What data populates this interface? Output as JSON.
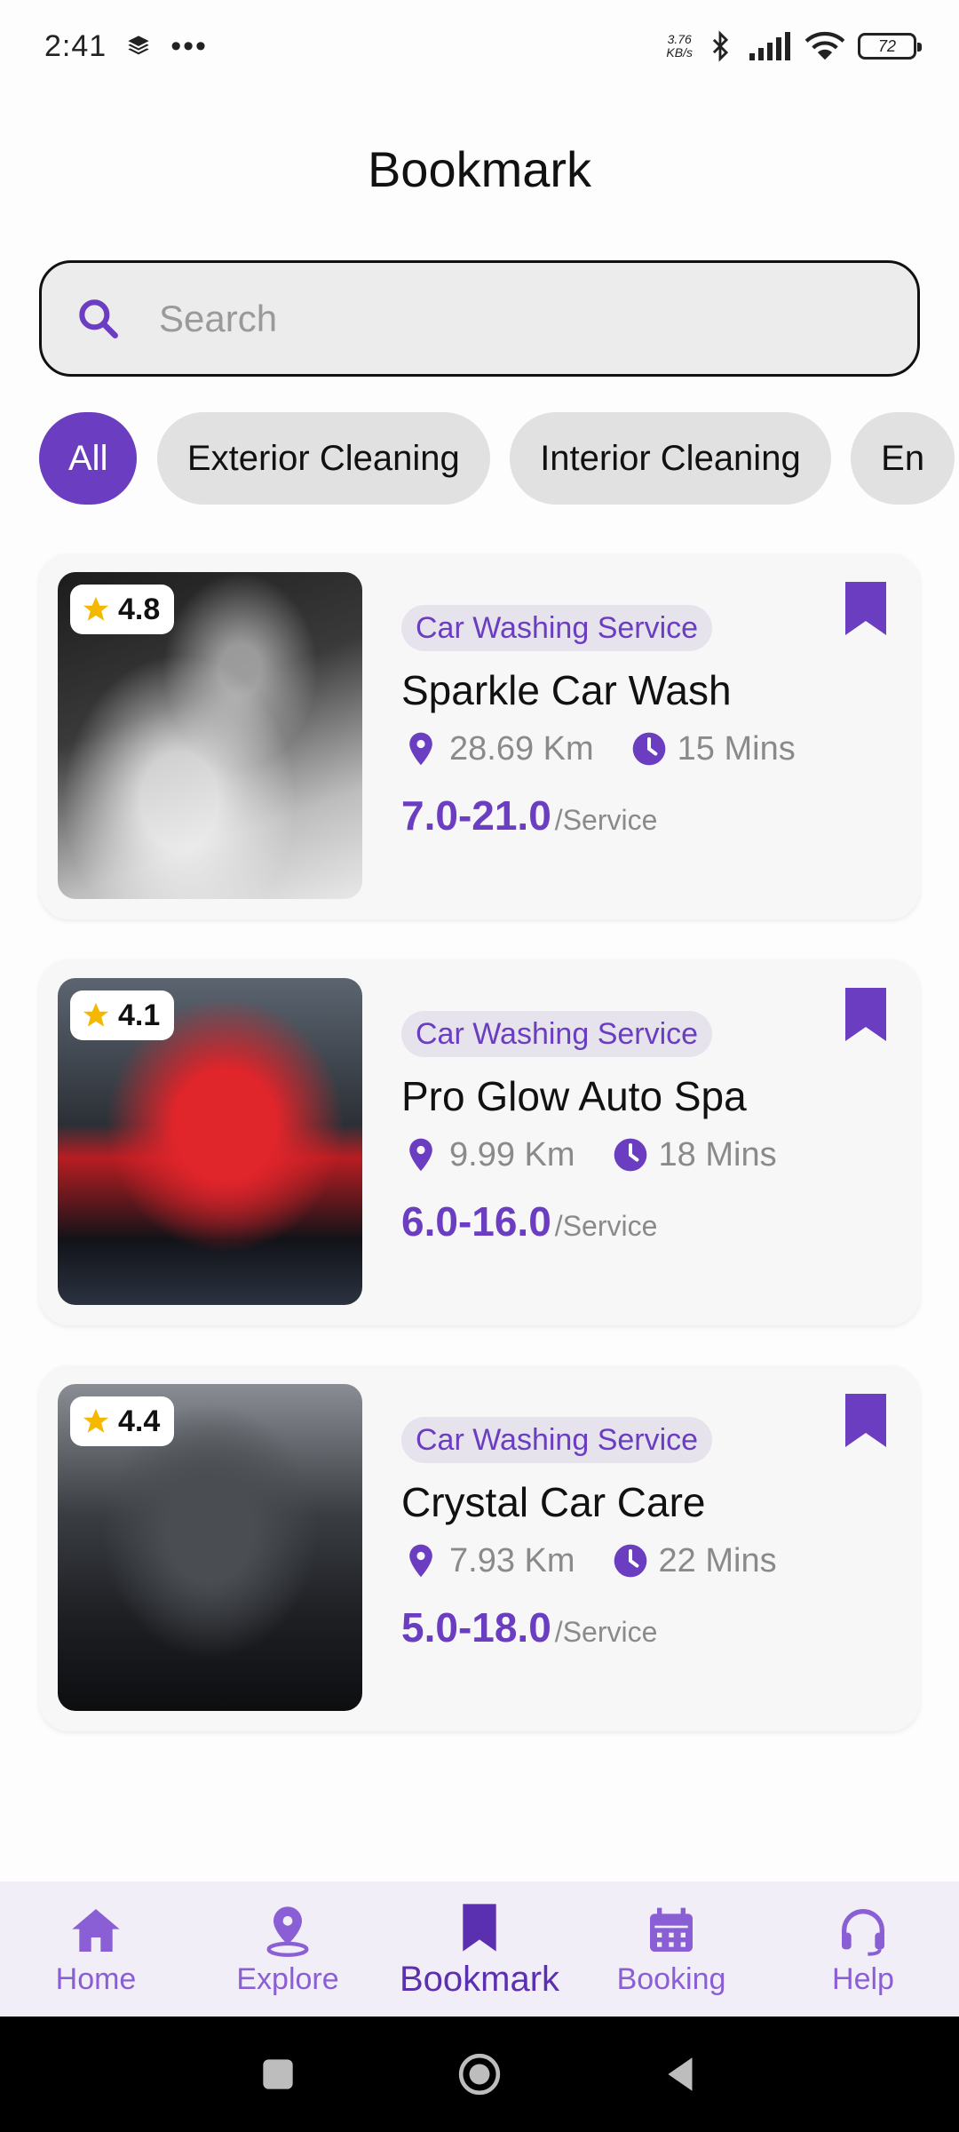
{
  "status_bar": {
    "time": "2:41",
    "more": "•••",
    "net_speed_value": "3.76",
    "net_speed_unit": "KB/s",
    "battery": "72"
  },
  "header": {
    "title": "Bookmark"
  },
  "search": {
    "placeholder": "Search"
  },
  "filters": [
    {
      "label": "All",
      "active": true
    },
    {
      "label": "Exterior Cleaning",
      "active": false
    },
    {
      "label": "Interior Cleaning",
      "active": false
    },
    {
      "label": "En",
      "active": false
    }
  ],
  "cards": [
    {
      "rating": "4.8",
      "category": "Car Washing Service",
      "name": "Sparkle Car Wash",
      "distance": "28.69 Km",
      "time": "15 Mins",
      "price": "7.0-21.0",
      "price_unit": "/Service"
    },
    {
      "rating": "4.1",
      "category": "Car Washing Service",
      "name": "Pro Glow Auto Spa",
      "distance": "9.99 Km",
      "time": "18 Mins",
      "price": "6.0-16.0",
      "price_unit": "/Service"
    },
    {
      "rating": "4.4",
      "category": "Car Washing Service",
      "name": "Crystal Car Care",
      "distance": "7.93 Km",
      "time": "22 Mins",
      "price": "5.0-18.0",
      "price_unit": "/Service"
    }
  ],
  "bottom_nav": [
    {
      "label": "Home",
      "icon": "home-icon"
    },
    {
      "label": "Explore",
      "icon": "location-pin-icon"
    },
    {
      "label": "Bookmark",
      "icon": "bookmark-icon",
      "active": true
    },
    {
      "label": "Booking",
      "icon": "calendar-icon"
    },
    {
      "label": "Help",
      "icon": "headset-icon"
    }
  ],
  "colors": {
    "accent": "#6a3dc1",
    "star": "#f5b800",
    "chip_bg": "#e1e1e1"
  }
}
